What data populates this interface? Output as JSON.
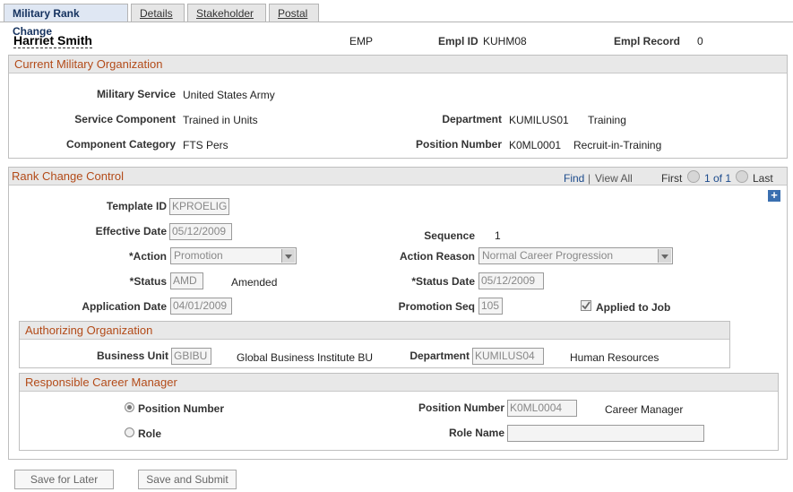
{
  "tabs": [
    "Military Rank Change",
    "Details",
    "Stakeholder",
    "Postal"
  ],
  "header": {
    "name": "Harriet Smith",
    "emp_type": "EMP",
    "empl_id_label": "Empl ID",
    "empl_id": "KUHM08",
    "empl_record_label": "Empl Record",
    "empl_record": "0"
  },
  "current_org": {
    "title": "Current Military Organization",
    "military_service_label": "Military Service",
    "military_service": "United States Army",
    "service_component_label": "Service Component",
    "service_component": "Trained in Units",
    "component_category_label": "Component Category",
    "component_category": "FTS Pers",
    "department_label": "Department",
    "department_code": "KUMILUS01",
    "department_name": "Training",
    "position_number_label": "Position Number",
    "position_number": "K0ML0001",
    "position_name": "Recruit-in-Training"
  },
  "rank_change": {
    "title": "Rank Change Control",
    "nav": {
      "find": "Find",
      "view_all": "View All",
      "first": "First",
      "count": "1 of 1",
      "last": "Last",
      "separator": "|"
    },
    "add_icon": "+",
    "template_id_label": "Template ID",
    "template_id": "KPROELIG",
    "effective_date_label": "Effective Date",
    "effective_date": "05/12/2009",
    "sequence_label": "Sequence",
    "sequence": "1",
    "action_label": "*Action",
    "action": "Promotion",
    "action_reason_label": "Action Reason",
    "action_reason": "Normal Career Progression",
    "status_label": "*Status",
    "status_code": "AMD",
    "status_desc": "Amended",
    "status_date_label": "*Status Date",
    "status_date": "05/12/2009",
    "application_date_label": "Application Date",
    "application_date": "04/01/2009",
    "promotion_seq_label": "Promotion Seq",
    "promotion_seq": "105",
    "applied_to_job_label": "Applied to Job"
  },
  "authorizing_org": {
    "title": "Authorizing Organization",
    "business_unit_label": "Business Unit",
    "business_unit": "GBIBU",
    "business_unit_name": "Global Business Institute BU",
    "department_label": "Department",
    "department_code": "KUMILUS04",
    "department_name": "Human Resources"
  },
  "career_manager": {
    "title": "Responsible Career Manager",
    "radio_position_label": "Position Number",
    "radio_role_label": "Role",
    "position_number_label": "Position Number",
    "position_number": "K0ML0004",
    "position_name": "Career Manager",
    "role_name_label": "Role Name",
    "role_name": ""
  },
  "buttons": {
    "save_later": "Save for Later",
    "save_submit": "Save and Submit"
  }
}
